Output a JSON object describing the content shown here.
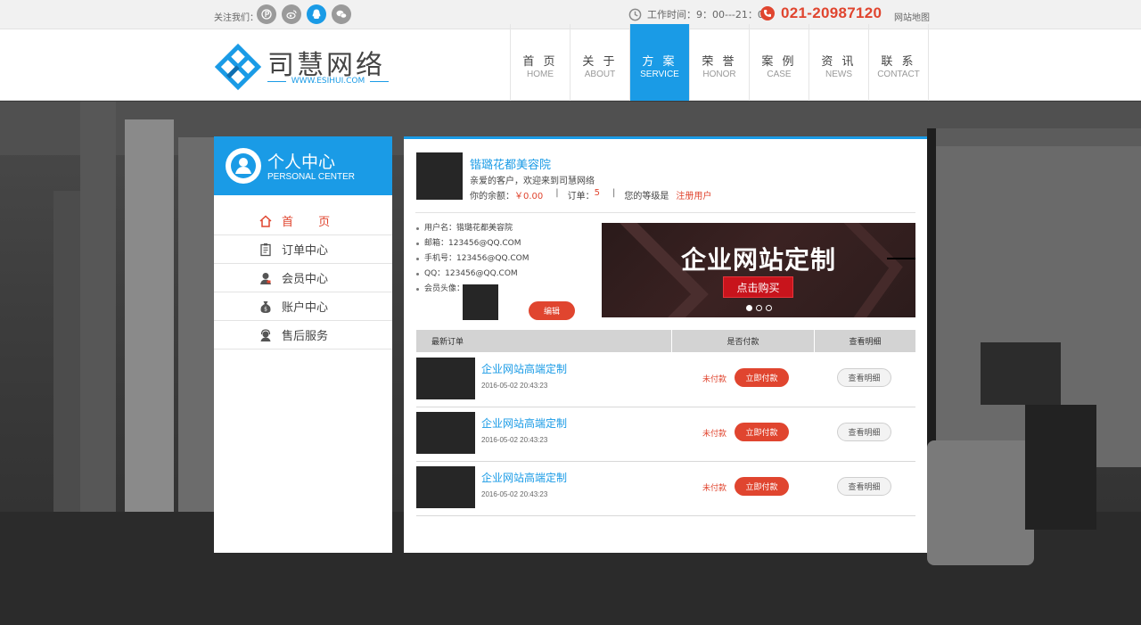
{
  "topbar": {
    "follow_label": "关注我们：",
    "social_icons": [
      "p-icon",
      "weibo-icon",
      "qq-icon",
      "wechat-icon"
    ],
    "work_hours": "工作时间：9：00---21：00",
    "phone": "021-20987120",
    "sitemap": "网站地图"
  },
  "logo": {
    "name": "司慧网络",
    "url": "WWW.ESIHUI.COM"
  },
  "nav": [
    {
      "cn": "首 页",
      "en": "HOME"
    },
    {
      "cn": "关 于",
      "en": "ABOUT"
    },
    {
      "cn": "方 案",
      "en": "SERVICE"
    },
    {
      "cn": "荣 誉",
      "en": "HONOR"
    },
    {
      "cn": "案 例",
      "en": "CASE"
    },
    {
      "cn": "资 讯",
      "en": "NEWS"
    },
    {
      "cn": "联 系",
      "en": "CONTACT"
    }
  ],
  "sidebar": {
    "title": "个人中心",
    "subtitle": "PERSONAL CENTER",
    "items": [
      {
        "label": "首 页",
        "icon": "home-icon"
      },
      {
        "label": "订单中心",
        "icon": "clipboard-icon"
      },
      {
        "label": "会员中心",
        "icon": "member-icon"
      },
      {
        "label": "账户中心",
        "icon": "money-bag-icon"
      },
      {
        "label": "售后服务",
        "icon": "support-icon"
      }
    ]
  },
  "profile": {
    "name": "锴璐花都美容院",
    "welcome": "亲爱的客户，欢迎来到司慧网络",
    "balance_label": "你的余额：",
    "balance_value": "￥0.00",
    "orders_label": "订单：",
    "orders_value": "5",
    "level_label": "您的等级是",
    "level_value": "注册用户"
  },
  "info": {
    "username": "用户名：锴璐花都美容院",
    "email": "邮箱：123456@QQ.COM",
    "mobile": "手机号：123456@QQ.COM",
    "qq": "QQ：123456@QQ.COM",
    "avatar_label": "会员头像：",
    "edit_button": "编辑"
  },
  "banner": {
    "title": "企业网站定制",
    "button": "点击购买",
    "slides": 3,
    "active_slide": 1
  },
  "orders": {
    "headers": [
      "最新订单",
      "是否付款",
      "查看明细"
    ],
    "rows": [
      {
        "title": "企业网站高端定制",
        "date": "2016-05-02 20:43:23",
        "status": "未付款",
        "pay_button": "立即付款",
        "detail_button": "查看明细"
      },
      {
        "title": "企业网站高端定制",
        "date": "2016-05-02 20:43:23",
        "status": "未付款",
        "pay_button": "立即付款",
        "detail_button": "查看明细"
      },
      {
        "title": "企业网站高端定制",
        "date": "2016-05-02 20:43:23",
        "status": "未付款",
        "pay_button": "立即付款",
        "detail_button": "查看明细"
      }
    ]
  },
  "colors": {
    "accent": "#1a9be6",
    "highlight": "#e0452f",
    "banner_button": "#c8141c"
  }
}
